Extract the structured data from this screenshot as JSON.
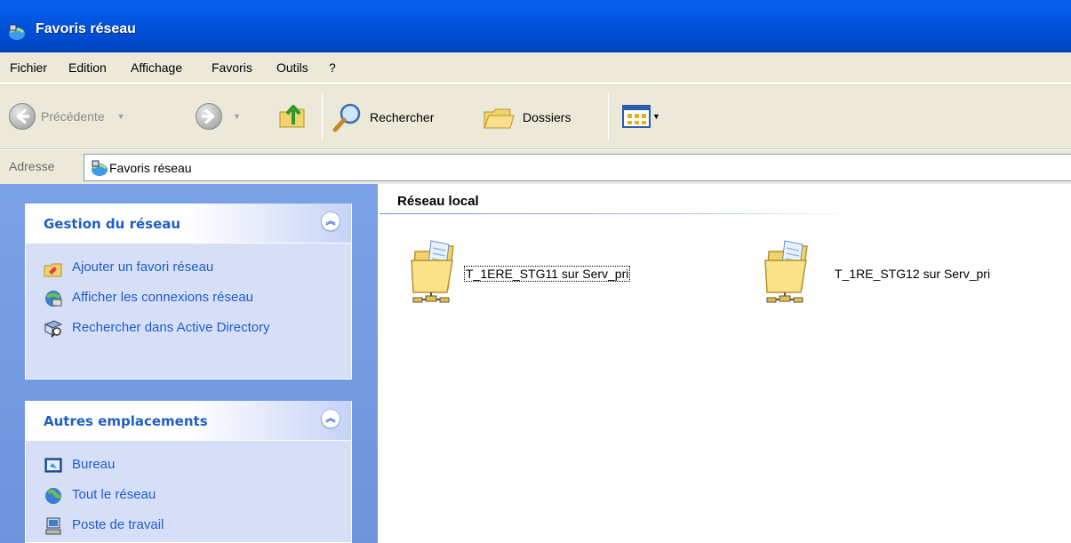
{
  "window": {
    "title": "Favoris réseau"
  },
  "menu": {
    "items": [
      "Fichier",
      "Edition",
      "Affichage",
      "Favoris",
      "Outils",
      "?"
    ]
  },
  "toolbar": {
    "back_label": "Précédente",
    "search_label": "Rechercher",
    "folders_label": "Dossiers"
  },
  "address": {
    "label": "Adresse",
    "value": "Favoris réseau"
  },
  "left_pane": {
    "panels": [
      {
        "title": "Gestion du réseau",
        "tasks": [
          {
            "label": "Ajouter un favori réseau",
            "icon": "add-network-place-icon"
          },
          {
            "label": "Afficher les connexions réseau",
            "icon": "network-connections-icon"
          },
          {
            "label": "Rechercher dans Active Directory",
            "icon": "search-directory-icon"
          }
        ]
      },
      {
        "title": "Autres emplacements",
        "tasks": [
          {
            "label": "Bureau",
            "icon": "desktop-icon"
          },
          {
            "label": "Tout le réseau",
            "icon": "entire-network-icon"
          },
          {
            "label": "Poste de travail",
            "icon": "my-computer-icon"
          }
        ]
      }
    ]
  },
  "content": {
    "group_title": "Réseau local",
    "items": [
      {
        "name": "T_1ERE_STG11 sur Serv_pri",
        "icon": "network-share-folder-icon",
        "focused": true
      },
      {
        "name": "T_1RE_STG12 sur Serv_pri",
        "icon": "network-share-folder-icon",
        "focused": false
      }
    ]
  },
  "colors": {
    "titlebar": "#0051d8",
    "chrome": "#ece9d8",
    "left_pane": "#7ba2e7",
    "task_link": "#215dc6"
  }
}
